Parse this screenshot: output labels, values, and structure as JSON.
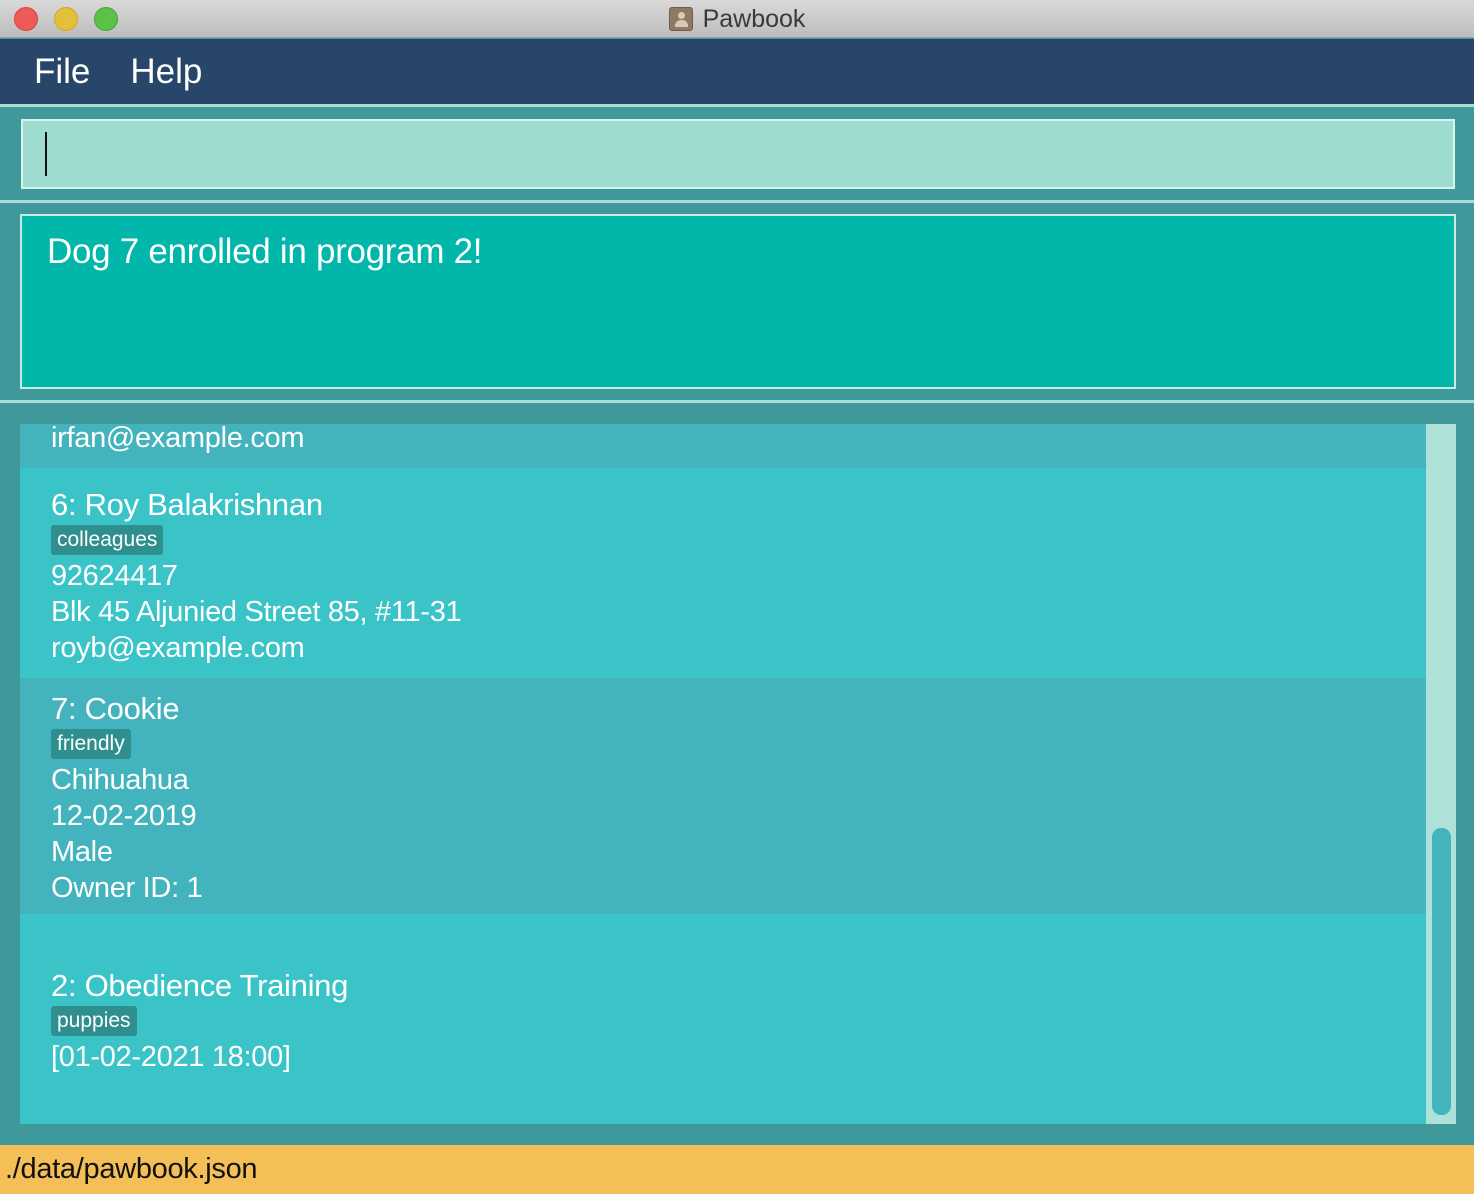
{
  "window": {
    "title": "Pawbook"
  },
  "menu": {
    "file": "File",
    "help": "Help"
  },
  "command": {
    "value": ""
  },
  "result": {
    "message": "Dog 7 enrolled in program 2!"
  },
  "list": {
    "partial_email": "irfan@example.com",
    "owner6": {
      "index": "6:",
      "name": "Roy Balakrishnan",
      "tag": "colleagues",
      "phone": "92624417",
      "address": "Blk 45 Aljunied Street 85, #11-31",
      "email": "royb@example.com"
    },
    "dog7": {
      "index": "7:",
      "name": "Cookie",
      "tag": "friendly",
      "breed": "Chihuahua",
      "dob": "12-02-2019",
      "sex": "Male",
      "owner": "Owner ID: 1"
    },
    "program2": {
      "index": "2:",
      "name": "Obedience Training",
      "tag": "puppies",
      "session": "[01-02-2021 18:00]"
    }
  },
  "status": {
    "path": "./data/pawbook.json"
  },
  "colors": {
    "menubar": "#28456a",
    "result": "#00b7aa",
    "card_main": "#3ac4c8",
    "card_alt": "#43b4bd",
    "tag": "#2f8f8f",
    "status": "#f3bf56"
  }
}
